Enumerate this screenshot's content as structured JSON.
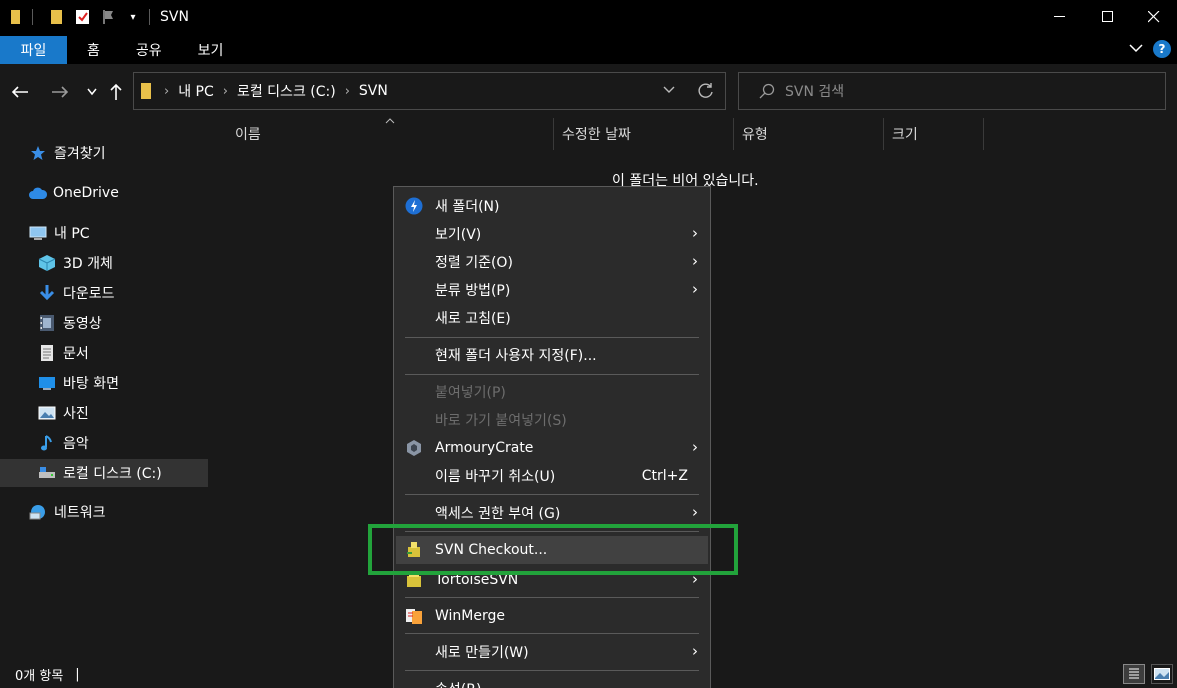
{
  "window": {
    "title": "SVN",
    "minimize": "—",
    "maximize": "☐",
    "close": "✕"
  },
  "ribbon": {
    "tabs": [
      "파일",
      "홈",
      "공유",
      "보기"
    ],
    "help": "?"
  },
  "address": {
    "crumbs": [
      "내 PC",
      "로컬 디스크 (C:)",
      "SVN"
    ],
    "separator": "›",
    "search_placeholder": "SVN 검색"
  },
  "nav": {
    "quick_access": "즐겨찾기",
    "onedrive": "OneDrive",
    "this_pc": "내 PC",
    "items": [
      "3D 개체",
      "다운로드",
      "동영상",
      "문서",
      "바탕 화면",
      "사진",
      "음악",
      "로컬 디스크 (C:)"
    ],
    "network": "네트워크"
  },
  "content": {
    "columns": [
      "이름",
      "수정한 날짜",
      "유형",
      "크기"
    ],
    "empty_message": "이 폴더는 비어 있습니다."
  },
  "status": {
    "item_count": "0개 항목",
    "divider": "|"
  },
  "context_menu": {
    "new_folder": "새 폴더(N)",
    "view": "보기(V)",
    "sort_by": "정렬 기준(O)",
    "group_by": "분류 방법(P)",
    "refresh": "새로 고침(E)",
    "customize": "현재 폴더 사용자 지정(F)...",
    "paste": "붙여넣기(P)",
    "paste_shortcut": "바로 가기 붙여넣기(S)",
    "armoury": "ArmouryCrate",
    "undo_rename": "이름 바꾸기 취소(U)",
    "undo_shortcut": "Ctrl+Z",
    "give_access": "액세스 권한 부여 (G)",
    "svn_checkout": "SVN Checkout...",
    "tortoise": "TortoiseSVN",
    "winmerge": "WinMerge",
    "new": "새로 만들기(W)",
    "properties": "속성(R)",
    "submenu_arrow": "›"
  },
  "colors": {
    "accent": "#1979ca",
    "highlight": "#22a33b",
    "menu_bg": "#2b2b2b"
  }
}
